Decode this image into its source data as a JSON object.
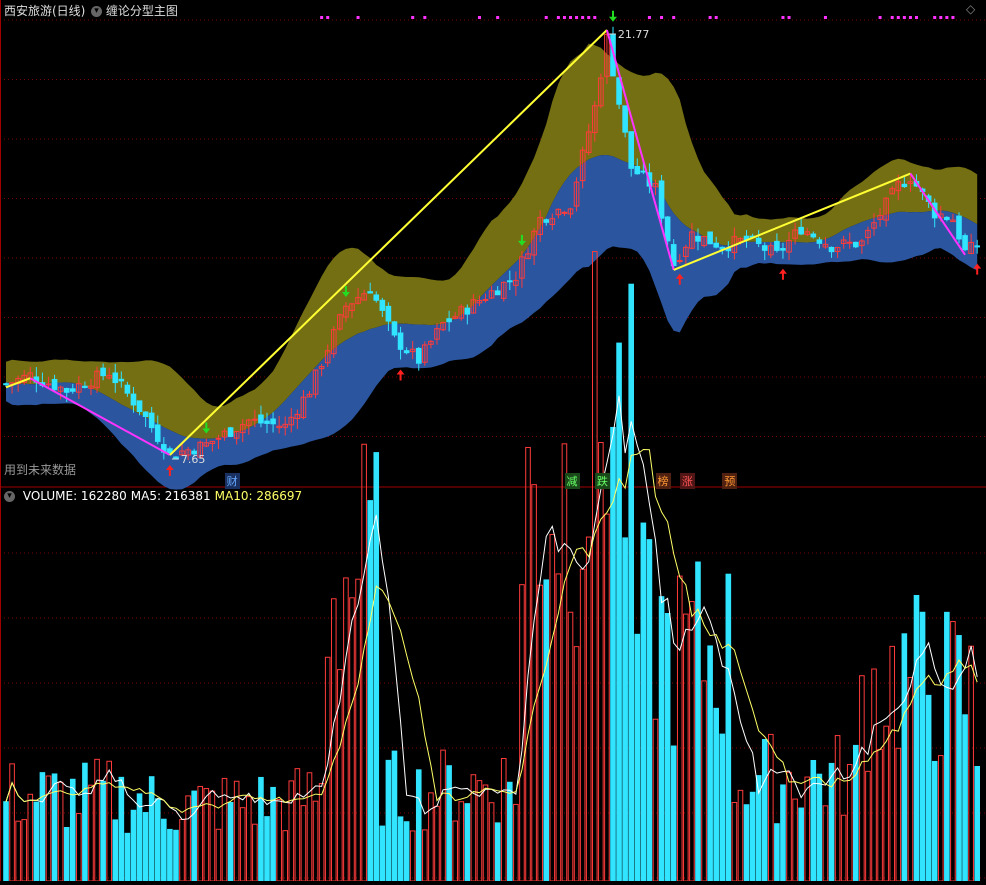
{
  "header": {
    "stock_title": "西安旅游(日线)",
    "indicator_title": "缠论分型主图",
    "future_data_note": "用到未来数据"
  },
  "colors": {
    "bg": "#000000",
    "up": "#ff3b3b",
    "down": "#31e4ff",
    "upper_band": "#7a7514",
    "lower_band": "#2d5aa8",
    "stroke_up": "#ffff33",
    "stroke_down": "#ff33ff",
    "grid": "#7a0000",
    "ma5": "#ffffff",
    "ma10": "#ffff66",
    "dots": "#ff33ff"
  },
  "event_labels": [
    {
      "text": "财",
      "bar": 37,
      "color": "#66aaff",
      "bg": "#1a3060"
    },
    {
      "text": "减",
      "bar": 93,
      "color": "#66ff66",
      "bg": "#1a4a1a"
    },
    {
      "text": "跌",
      "bar": 98,
      "color": "#66ff66",
      "bg": "#1a4a1a"
    },
    {
      "text": "榜",
      "bar": 108,
      "color": "#ff9933",
      "bg": "#502010"
    },
    {
      "text": "涨",
      "bar": 112,
      "color": "#ff5555",
      "bg": "#501515"
    },
    {
      "text": "预",
      "bar": 119,
      "color": "#ff9933",
      "bg": "#502010"
    }
  ],
  "chart_data": [
    {
      "type": "candlestick",
      "title": "西安旅游(日线)",
      "indicator": "缠论分型主图",
      "annotations": [
        {
          "text": "21.77",
          "bar": 99,
          "kind": "high"
        },
        {
          "text": "7.65",
          "bar": 27,
          "kind": "low"
        }
      ],
      "strokes": [
        {
          "from": {
            "bar": 0,
            "price": 9.9
          },
          "to": {
            "bar": 4,
            "price": 10.2
          },
          "dir": "up"
        },
        {
          "from": {
            "bar": 4,
            "price": 10.2
          },
          "to": {
            "bar": 27,
            "price": 7.65
          },
          "dir": "down"
        },
        {
          "from": {
            "bar": 27,
            "price": 7.65
          },
          "to": {
            "bar": 99,
            "price": 21.77
          },
          "dir": "up"
        },
        {
          "from": {
            "bar": 99,
            "price": 21.77
          },
          "to": {
            "bar": 110,
            "price": 13.8
          },
          "dir": "down"
        },
        {
          "from": {
            "bar": 110,
            "price": 13.8
          },
          "to": {
            "bar": 149,
            "price": 17.0
          },
          "dir": "up"
        },
        {
          "from": {
            "bar": 149,
            "price": 17.0
          },
          "to": {
            "bar": 158,
            "price": 14.3
          },
          "dir": "down"
        }
      ],
      "signals": [
        {
          "bar": 27,
          "dir": "up"
        },
        {
          "bar": 33,
          "dir": "down"
        },
        {
          "bar": 56,
          "dir": "down"
        },
        {
          "bar": 65,
          "dir": "up"
        },
        {
          "bar": 85,
          "dir": "down"
        },
        {
          "bar": 100,
          "dir": "down"
        },
        {
          "bar": 111,
          "dir": "up"
        },
        {
          "bar": 128,
          "dir": "up"
        },
        {
          "bar": 160,
          "dir": "up"
        }
      ],
      "top_dots": [
        52,
        53,
        58,
        67,
        69,
        78,
        81,
        89,
        91,
        92,
        93,
        94,
        95,
        96,
        97,
        106,
        108,
        110,
        116,
        117,
        128,
        129,
        135,
        144,
        146,
        147,
        148,
        149,
        150,
        153,
        154,
        155,
        156
      ]
    },
    {
      "type": "bar",
      "title": "VOLUME",
      "metrics": [
        {
          "label": "VOLUME",
          "value": "162280",
          "color": "#ffffff"
        },
        {
          "label": "MA5",
          "value": "216381",
          "color": "#ffffff"
        },
        {
          "label": "MA10",
          "value": "286697",
          "color": "#ffff66"
        }
      ],
      "series": [
        "volume",
        "MA5",
        "MA10"
      ]
    }
  ]
}
